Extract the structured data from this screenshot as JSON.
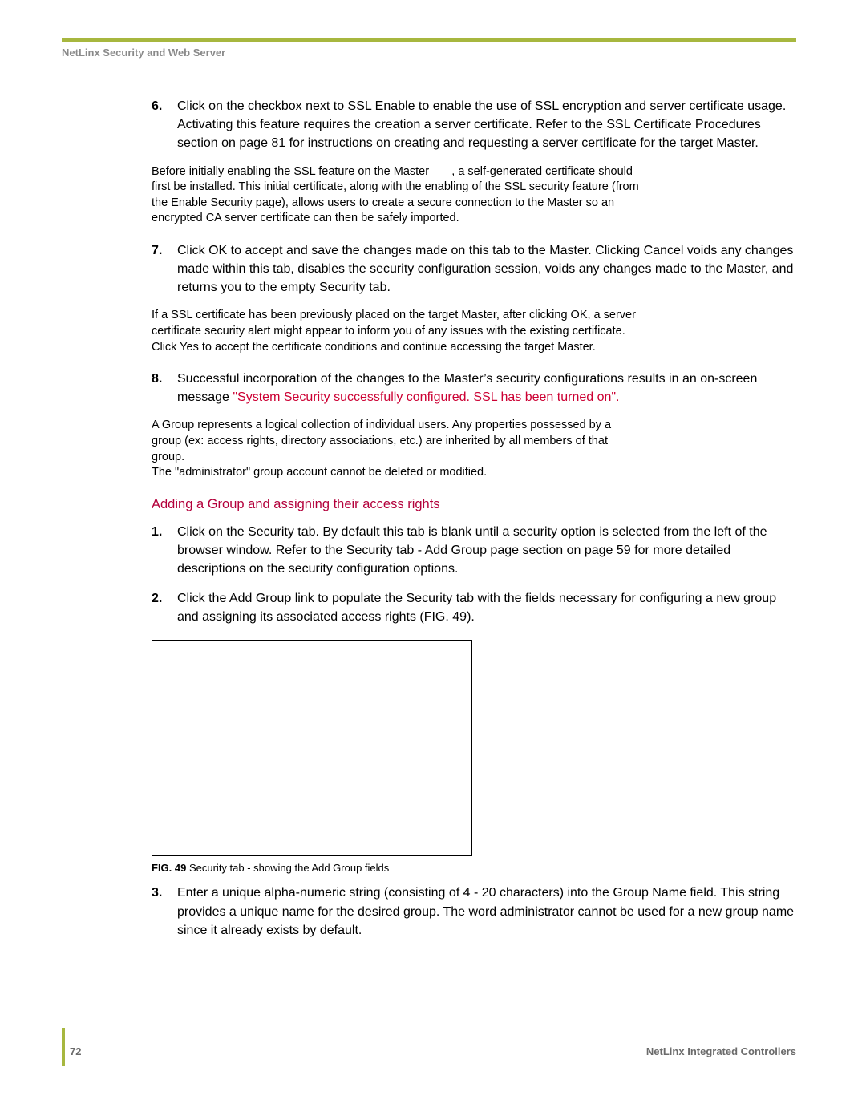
{
  "header": "NetLinx Security and Web Server",
  "step6": "Click on the checkbox next to SSL Enable to enable the use of SSL encryption and server certificate usage. Activating this feature requires the creation a server certificate. Refer to the SSL Certificate Procedures section on page 81 for instructions on creating and requesting a server certificate for the target Master.",
  "note1": "Before initially enabling the SSL feature on the Master       , a self-generated certificate should first be installed. This initial certificate, along with the enabling of the SSL security feature (from the Enable Security page), allows users to create a secure connection to the Master so an encrypted CA server certificate can then be safely imported.",
  "step7": "Click OK to accept and save the changes made on this tab to the Master. Clicking Cancel voids any changes made within this tab, disables the security configuration session, voids any changes made to the Master, and returns you to the empty Security tab.",
  "note2": "If a SSL certificate has been previously placed on the target Master, after clicking OK, a server certificate security alert might appear to inform you of any issues with the existing certificate. Click Yes to accept the certificate conditions and continue accessing the target Master.",
  "step8_a": "Successful incorporation of the changes to the Master’s security configurations results in an on-screen message ",
  "step8_red": "\"System Security successfully configured. SSL has been turned on\".",
  "note3": "A Group represents a logical collection of individual users. Any properties possessed by a group (ex: access rights, directory associations, etc.) are inherited by all members of that group.\nThe \"administrator\" group account cannot be deleted or modified.",
  "section_head": "Adding a Group and assigning their access rights",
  "step1": "Click on the Security tab. By default this tab is blank until a security option is selected from the left of the browser window. Refer to the Security tab - Add Group page section on page 59 for more detailed descriptions on the security configuration options.",
  "step2": "Click the Add Group link to populate the Security tab with the fields necessary for configuring a new group and assigning its associated access rights (FIG. 49).",
  "figlabel": "FIG. 49",
  "figcap": " Security tab - showing the Add Group fields",
  "step3": "Enter a unique alpha-numeric string (consisting of 4 - 20 characters) into the Group Name field. This string provides a unique name for the desired group. The word administrator cannot be used for a new group name since it already exists by default.",
  "footer": {
    "page": "72",
    "title": "NetLinx Integrated Controllers"
  }
}
